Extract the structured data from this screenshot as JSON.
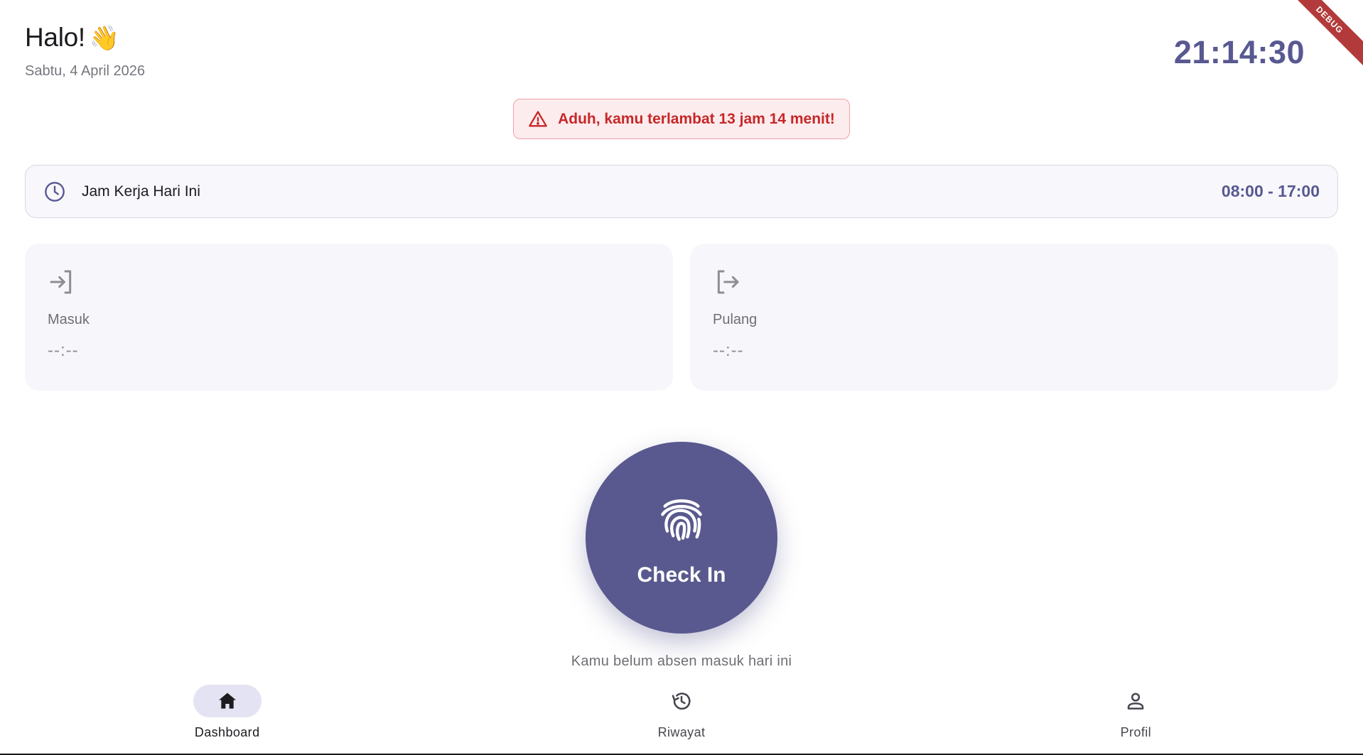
{
  "header": {
    "greeting": "Halo!",
    "greeting_emoji": "👋",
    "date": "Sabtu, 4 April 2026",
    "clock": "21:14:30"
  },
  "debug_banner": "DEBUG",
  "alert": {
    "icon": "warning-triangle-icon",
    "message": "Aduh, kamu terlambat 13 jam 14 menit!"
  },
  "work_hours": {
    "icon": "clock-icon",
    "label": "Jam Kerja Hari Ini",
    "value": "08:00 - 17:00"
  },
  "attendance": {
    "check_in": {
      "icon": "login-icon",
      "label": "Masuk",
      "time": "--:--"
    },
    "check_out": {
      "icon": "logout-icon",
      "label": "Pulang",
      "time": "--:--"
    }
  },
  "action": {
    "icon": "fingerprint-icon",
    "label": "Check In",
    "hint": "Kamu belum absen masuk hari ini"
  },
  "nav": {
    "items": [
      {
        "label": "Dashboard",
        "icon": "home-icon",
        "active": true
      },
      {
        "label": "Riwayat",
        "icon": "history-icon",
        "active": false
      },
      {
        "label": "Profil",
        "icon": "person-icon",
        "active": false
      }
    ]
  },
  "colors": {
    "primary": "#585991",
    "alert_text": "#c62828",
    "alert_bg": "#fdecee",
    "card_bg": "#f7f7fb"
  }
}
